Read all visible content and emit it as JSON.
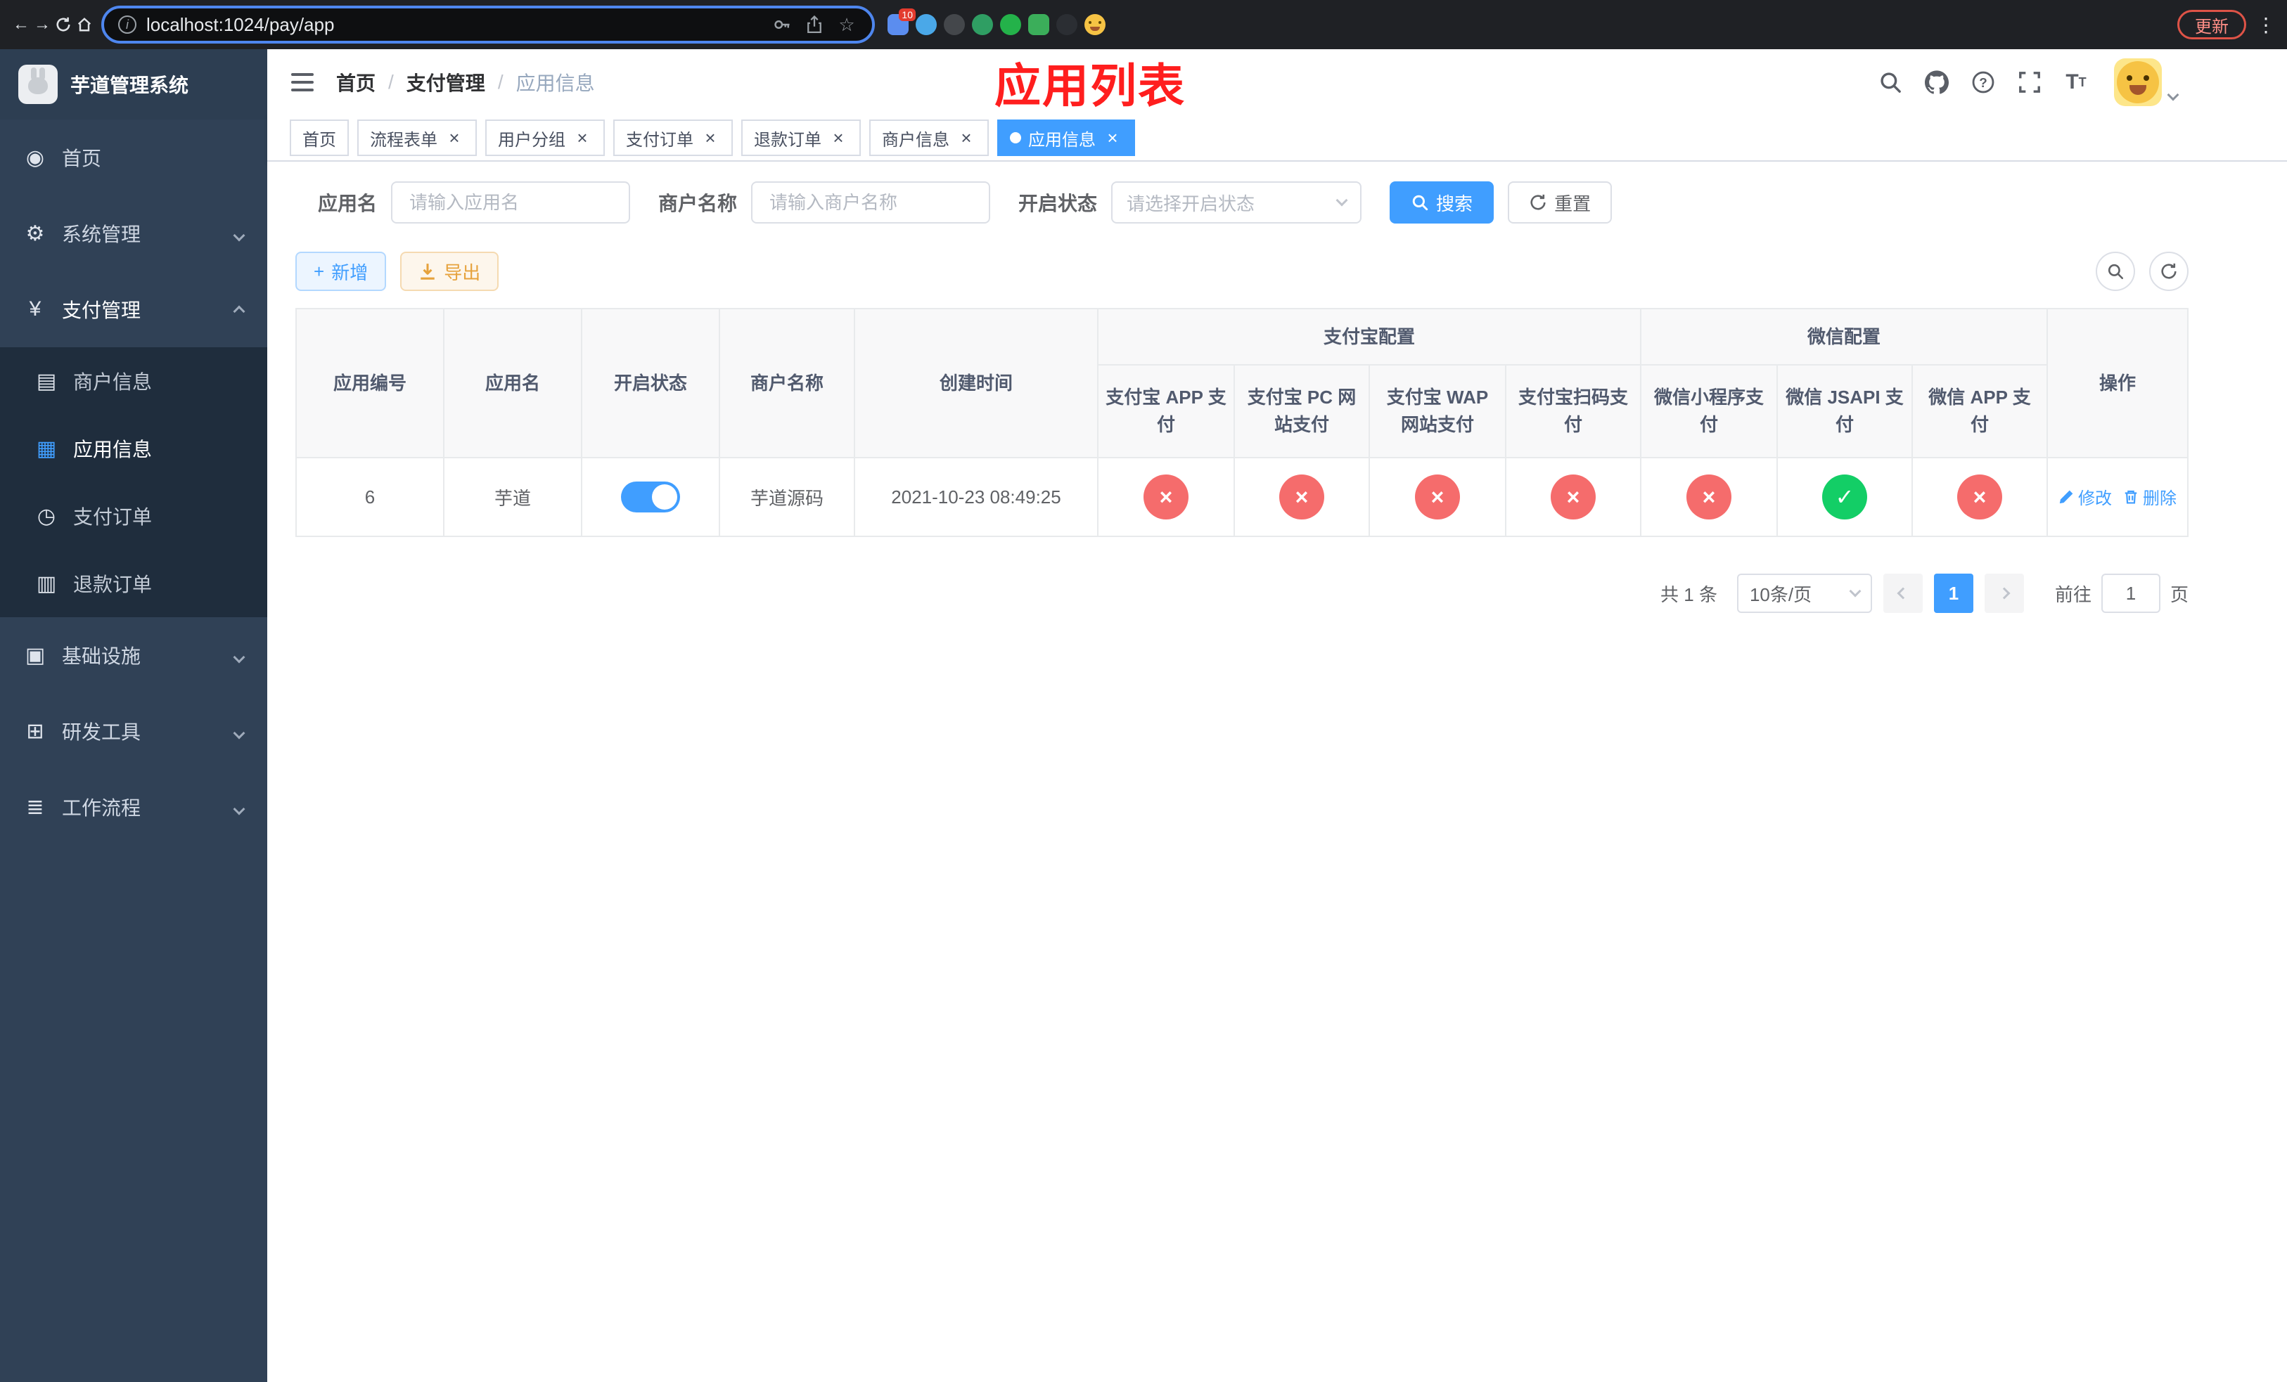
{
  "chrome": {
    "url": "localhost:1024/pay/app",
    "update_label": "更新",
    "extension_badge": "10"
  },
  "sidebar": {
    "title": "芋道管理系统",
    "home": "首页",
    "system": "系统管理",
    "payment": "支付管理",
    "merchant_info": "商户信息",
    "app_info": "应用信息",
    "pay_order": "支付订单",
    "refund_order": "退款订单",
    "infra": "基础设施",
    "devtools": "研发工具",
    "workflow": "工作流程"
  },
  "breadcrumb": {
    "home": "首页",
    "payment": "支付管理",
    "app_info": "应用信息",
    "separator": "/"
  },
  "overlay_title": "应用列表",
  "tabs": [
    {
      "label": "首页",
      "active": false,
      "closable": false
    },
    {
      "label": "流程表单",
      "active": false,
      "closable": true
    },
    {
      "label": "用户分组",
      "active": false,
      "closable": true
    },
    {
      "label": "支付订单",
      "active": false,
      "closable": true
    },
    {
      "label": "退款订单",
      "active": false,
      "closable": true
    },
    {
      "label": "商户信息",
      "active": false,
      "closable": true
    },
    {
      "label": "应用信息",
      "active": true,
      "closable": true
    }
  ],
  "filters": {
    "app_name_label": "应用名",
    "app_name_placeholder": "请输入应用名",
    "merchant_label": "商户名称",
    "merchant_placeholder": "请输入商户名称",
    "status_label": "开启状态",
    "status_placeholder": "请选择开启状态",
    "search_label": "搜索",
    "reset_label": "重置"
  },
  "toolbar": {
    "add_label": "新增",
    "export_label": "导出"
  },
  "table": {
    "columns": {
      "app_id": "应用编号",
      "app_name": "应用名",
      "status": "开启状态",
      "merchant_name": "商户名称",
      "create_time": "创建时间",
      "alipay_group": "支付宝配置",
      "wechat_group": "微信配置",
      "alipay_app": "支付宝 APP 支付",
      "alipay_pc": "支付宝 PC 网站支付",
      "alipay_wap": "支付宝 WAP 网站支付",
      "alipay_qr": "支付宝扫码支付",
      "wx_mini": "微信小程序支付",
      "wx_jsapi": "微信 JSAPI 支付",
      "wx_app": "微信 APP 支付",
      "actions": "操作"
    },
    "rows": [
      {
        "app_id": "6",
        "app_name": "芋道",
        "status_on": true,
        "merchant_name": "芋道源码",
        "create_time": "2021-10-23 08:49:25",
        "alipay_app": false,
        "alipay_pc": false,
        "alipay_wap": false,
        "alipay_qr": false,
        "wx_mini": false,
        "wx_jsapi": true,
        "wx_app": false,
        "edit_label": "修改",
        "delete_label": "删除"
      }
    ]
  },
  "pagination": {
    "total": "共 1 条",
    "page_size": "10条/页",
    "page": "1",
    "goto_label": "前往",
    "goto_value": "1",
    "unit_label": "页"
  },
  "icons": {
    "back": "←",
    "forward": "→",
    "star": "☆",
    "kebab": "⋮",
    "info": "i",
    "close": "×",
    "dot": "●",
    "plus": "+",
    "check": "✓",
    "cross": "×",
    "menu_home": "◉",
    "menu_system": "⚙",
    "menu_payment": "¥",
    "menu_merchant": "▤",
    "menu_app": "▦",
    "menu_pay_order": "◷",
    "menu_refund": "▥",
    "menu_infra": "▣",
    "menu_devtools": "⊞",
    "menu_workflow": "≣"
  },
  "colors": {
    "primary": "#409eff",
    "success": "#13ce66",
    "danger": "#f56c6c",
    "annotation_red": "#ff1e1e"
  }
}
